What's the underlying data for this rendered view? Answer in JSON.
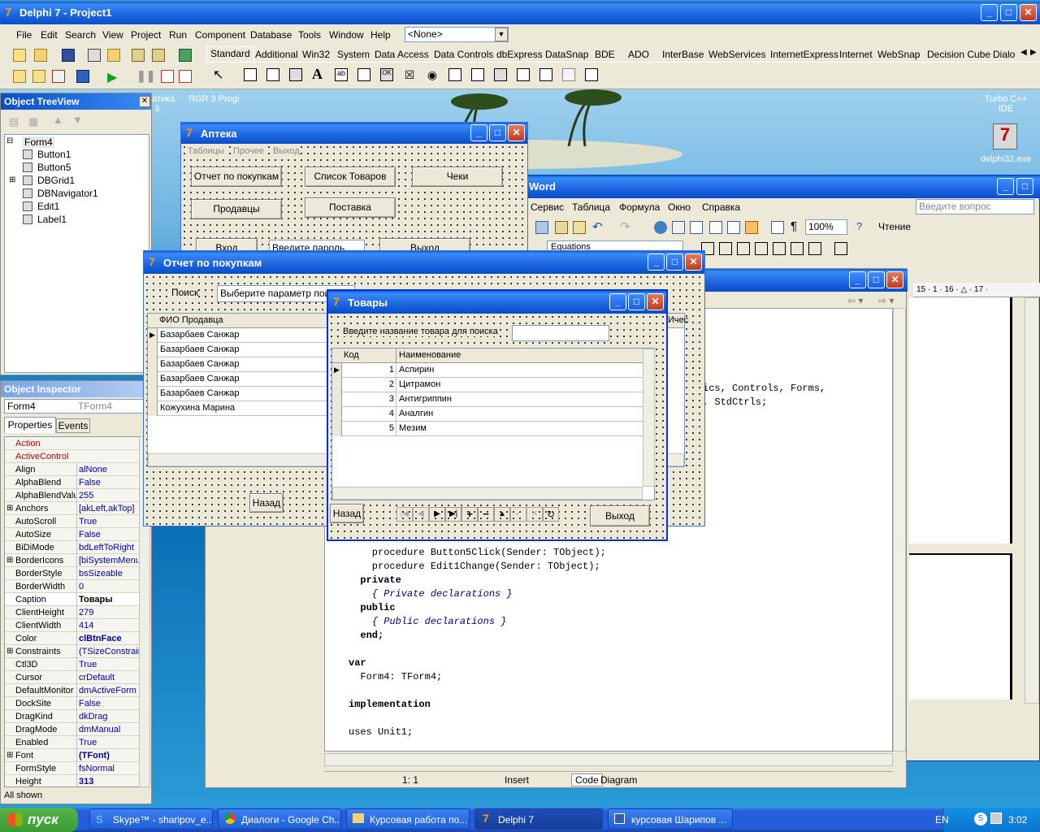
{
  "main_title": "Delphi 7 - Project1",
  "menu": [
    "File",
    "Edit",
    "Search",
    "View",
    "Project",
    "Run",
    "Component",
    "Database",
    "Tools",
    "Window",
    "Help"
  ],
  "none_combo": "<None>",
  "palette_tabs": [
    "Standard",
    "Additional",
    "Win32",
    "System",
    "Data Access",
    "Data Controls",
    "dbExpress",
    "DataSnap",
    "BDE",
    "ADO",
    "InterBase",
    "WebServices",
    "InternetExpress",
    "Internet",
    "WebSnap",
    "Decision Cube",
    "Dialo"
  ],
  "desktop": {
    "text1": "атика",
    "text2": "RGR 3 Progi",
    "text3": "3",
    "turbo": "Turbo C++\nIDE",
    "delphi_icon": "delphi32.exe"
  },
  "tree": {
    "title": "Object TreeView",
    "items": [
      "Form4",
      "Button1",
      "Button5",
      "DBGrid1",
      "DBNavigator1",
      "Edit1",
      "Label1"
    ]
  },
  "inspector": {
    "title": "Object Inspector",
    "object": "Form4",
    "object_type": "TForm4",
    "tabs": [
      "Properties",
      "Events"
    ],
    "footer": "All shown",
    "props": [
      [
        "Action",
        ""
      ],
      [
        "ActiveControl",
        ""
      ],
      [
        "Align",
        "alNone"
      ],
      [
        "AlphaBlend",
        "False"
      ],
      [
        "AlphaBlendValu",
        "255"
      ],
      [
        "Anchors",
        "[akLeft,akTop]"
      ],
      [
        "AutoScroll",
        "True"
      ],
      [
        "AutoSize",
        "False"
      ],
      [
        "BiDiMode",
        "bdLeftToRight"
      ],
      [
        "BorderIcons",
        "[biSystemMenu,"
      ],
      [
        "BorderStyle",
        "bsSizeable"
      ],
      [
        "BorderWidth",
        "0"
      ],
      [
        "Caption",
        "Товары"
      ],
      [
        "ClientHeight",
        "279"
      ],
      [
        "ClientWidth",
        "414"
      ],
      [
        "Color",
        "clBtnFace"
      ],
      [
        "Constraints",
        "(TSizeConstrain"
      ],
      [
        "Ctl3D",
        "True"
      ],
      [
        "Cursor",
        "crDefault"
      ],
      [
        "DefaultMonitor",
        "dmActiveForm"
      ],
      [
        "DockSite",
        "False"
      ],
      [
        "DragKind",
        "dkDrag"
      ],
      [
        "DragMode",
        "dmManual"
      ],
      [
        "Enabled",
        "True"
      ],
      [
        "Font",
        "(TFont)"
      ],
      [
        "FormStyle",
        "fsNormal"
      ],
      [
        "Height",
        "313"
      ]
    ]
  },
  "apteka": {
    "title": "Аптека",
    "menu": [
      "Таблицы",
      "Прочее",
      "Выход"
    ],
    "buttons": [
      "Отчет по покупкам",
      "Список Товаров",
      "Чеки",
      "Продавцы",
      "Поставка"
    ],
    "login": "Вход",
    "password": "Введите пароль",
    "exit": "Выход"
  },
  "report": {
    "title": "Отчет по покупкам",
    "search_label": "Поиск",
    "search_value": "Выберите параметр поиска",
    "col": "ФИО Продавца",
    "col2": "Ичес",
    "rows": [
      "Базарбаев Санжар",
      "Базарбаев Санжар",
      "Базарбаев Санжар",
      "Базарбаев Санжар",
      "Базарбаев Санжар",
      "Кожухина Марина"
    ],
    "back": "Назад"
  },
  "tovary": {
    "title": "Товары",
    "label": "Введите название товара для поиска",
    "cols": [
      "Код",
      "Наименование"
    ],
    "rows": [
      [
        "1",
        "Аспирин"
      ],
      [
        "2",
        "Цитрамон"
      ],
      [
        "3",
        "Антигриппин"
      ],
      [
        "4",
        "Аналгин"
      ],
      [
        "5",
        "Мезим"
      ]
    ],
    "back": "Назад",
    "exit": "Выход"
  },
  "word": {
    "title": "Word",
    "menu": [
      "Сервис",
      "Таблица",
      "Формула",
      "Окно",
      "Справка"
    ],
    "ask": "Введите вопрос",
    "zoom": "100%",
    "read": "Чтение",
    "equations": "Equations",
    "ruler": "15 · 1 · 16 · △ · 17 ·"
  },
  "editor": {
    "lines": [
      {
        "t": "    procedure Button5Click(Sender: TObject);",
        "b": false
      },
      {
        "t": "    procedure Edit1Change(Sender: TObject);",
        "b": false
      },
      {
        "t": "  private",
        "b": true
      },
      {
        "t": "    { Private declarations }",
        "b": false,
        "i": true
      },
      {
        "t": "  public",
        "b": true
      },
      {
        "t": "    { Public declarations }",
        "b": false,
        "i": true
      },
      {
        "t": "  end;",
        "b": true
      },
      {
        "t": "",
        "b": false
      },
      {
        "t": "var",
        "b": true
      },
      {
        "t": "  Form4: TForm4;",
        "b": false
      },
      {
        "t": "",
        "b": false
      },
      {
        "t": "implementation",
        "b": true
      },
      {
        "t": "",
        "b": false
      },
      {
        "t": "uses Unit1;",
        "b": false
      }
    ],
    "frag1": "ics, Controls, Forms,",
    "frag2": ", StdCtrls;",
    "status_pos": "1:  1",
    "status_mode": "Insert",
    "tab_code": "Code",
    "tab_diagram": "Diagram"
  },
  "taskbar": {
    "start": "пуск",
    "items": [
      "Skype™ - sharipov_e...",
      "Диалоги - Google Ch...",
      "Курсовая работа по...",
      "Delphi 7",
      "курсовая Шарипов ..."
    ],
    "lang": "EN",
    "time": "3:02"
  }
}
